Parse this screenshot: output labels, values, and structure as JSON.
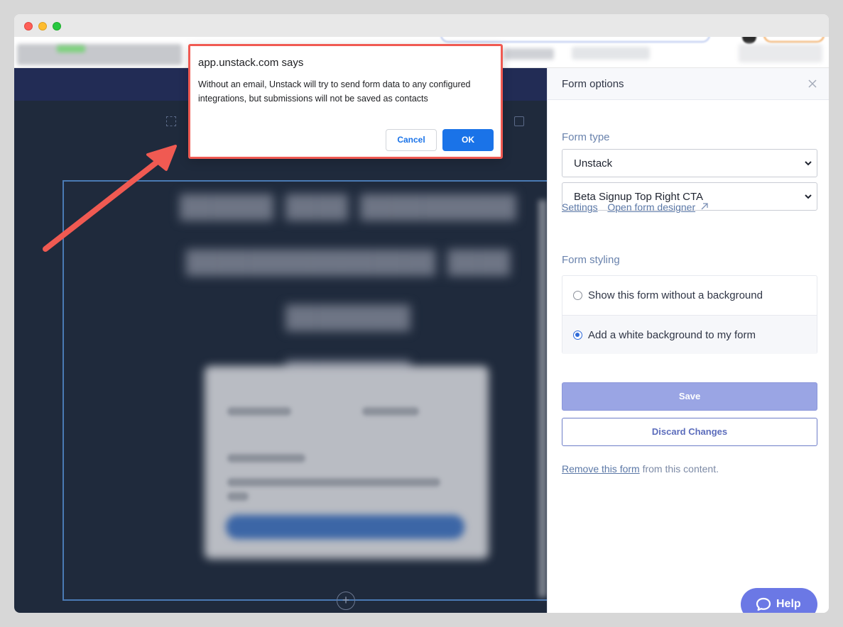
{
  "dialog": {
    "origin": "app.unstack.com says",
    "message": "Without an email, Unstack will try to send form data to any configured integrations, but submissions will not be saved as contacts",
    "cancel_label": "Cancel",
    "ok_label": "OK"
  },
  "panel": {
    "title": "Form options",
    "form_type_label": "Form type",
    "form_type_value": "Unstack",
    "form_value": "Beta Signup Top Right CTA",
    "settings_link": "Settings",
    "designer_link": "Open form designer",
    "form_styling_label": "Form styling",
    "styling_options": [
      {
        "label": "Show this form without a background",
        "selected": false
      },
      {
        "label": "Add a white background to my form",
        "selected": true
      }
    ],
    "save_label": "Save",
    "discard_label": "Discard Changes",
    "remove_link": "Remove this form",
    "remove_suffix": " from this content."
  },
  "help": {
    "label": "Help"
  },
  "icons": {
    "close": "close-icon",
    "external": "external-link-icon",
    "chevron": "chevron-down-icon",
    "chat": "chat-bubble-icon",
    "add": "plus-icon"
  },
  "colors": {
    "annotation": "#f05a52",
    "primary": "#1a73e8",
    "help_button": "#6b78e5",
    "save_button": "#9aa5e4",
    "editor_background": "#1f2a3c"
  }
}
